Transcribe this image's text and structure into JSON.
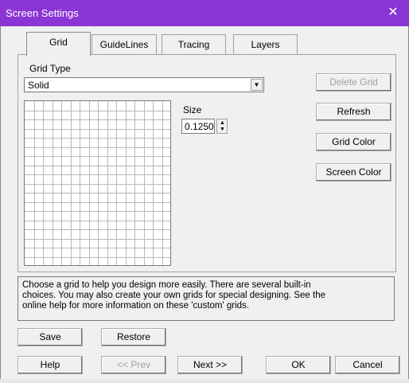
{
  "window": {
    "title": "Screen Settings",
    "close_glyph": "✕",
    "accent": "#8b35d6"
  },
  "tabs": [
    {
      "label": "Grid",
      "active": true
    },
    {
      "label": "GuideLines",
      "active": false
    },
    {
      "label": "Tracing",
      "active": false
    },
    {
      "label": "Layers",
      "active": false
    }
  ],
  "grid": {
    "type_label": "Grid Type",
    "type_value": "Solid",
    "size_label": "Size",
    "size_value": "0.1250"
  },
  "side_buttons": {
    "delete": "Delete Grid",
    "refresh": "Refresh",
    "grid_color": "Grid Color",
    "screen_color": "Screen Color"
  },
  "description": "Choose a grid to help you design more easily. There are several built-in choices. You may also create your own grids for special designing. See the online help for more information on these 'custom' grids.",
  "description_lines": [
    "Choose a grid to help you design more easily. There are several built-in",
    "choices. You may also create your own grids for special designing. See the",
    "online help for more information on these 'custom' grids."
  ],
  "footer": {
    "save": "Save",
    "restore": "Restore",
    "help": "Help",
    "prev": "<< Prev",
    "next": "Next >>",
    "ok": "OK",
    "cancel": "Cancel"
  }
}
